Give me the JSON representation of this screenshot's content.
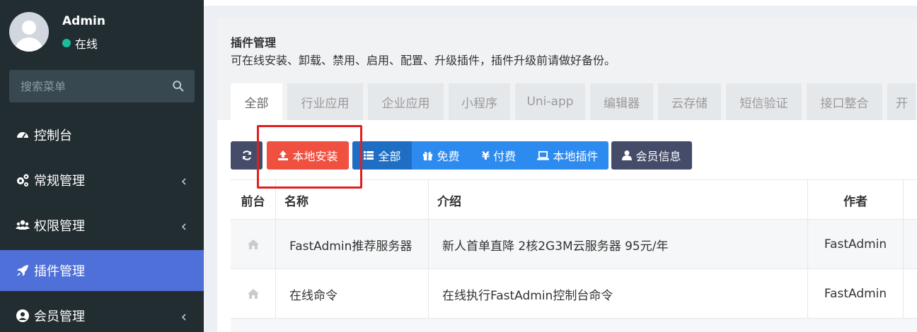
{
  "user": {
    "name": "Admin",
    "status": "在线"
  },
  "search": {
    "placeholder": "搜索菜单"
  },
  "sidebar": {
    "items": [
      {
        "label": "控制台",
        "icon": "dashboard-icon"
      },
      {
        "label": "常规管理",
        "icon": "cogs-icon"
      },
      {
        "label": "权限管理",
        "icon": "users-icon"
      },
      {
        "label": "插件管理",
        "icon": "rocket-icon",
        "active": true
      },
      {
        "label": "会员管理",
        "icon": "user-circle-icon"
      }
    ]
  },
  "page": {
    "title": "插件管理",
    "description": "可在线安装、卸载、禁用、启用、配置、升级插件，插件升级前请做好备份。"
  },
  "tabs": [
    "全部",
    "行业应用",
    "企业应用",
    "小程序",
    "Uni-app",
    "编辑器",
    "云存储",
    "短信验证",
    "接口整合",
    "开"
  ],
  "toolbar": {
    "local_install": "本地安装",
    "all": "全部",
    "free": "免费",
    "paid": "付费",
    "local_plugins": "本地插件",
    "member_info": "会员信息"
  },
  "table": {
    "headers": [
      "前台",
      "名称",
      "介绍",
      "作者"
    ],
    "rows": [
      {
        "name": "FastAdmin推荐服务器",
        "intro": "新人首单直降 2核2G3M云服务器 95元/年",
        "author": "FastAdmin"
      },
      {
        "name": "在线命令",
        "intro": "在线执行FastAdmin控制台命令",
        "author": "FastAdmin"
      }
    ]
  },
  "colors": {
    "sidebar": "#222d32",
    "active_menu": "#4f70d8",
    "danger": "#f0503f",
    "primary": "#2d8bf0",
    "dark_btn": "#444c69",
    "highlight": "#e02020"
  }
}
